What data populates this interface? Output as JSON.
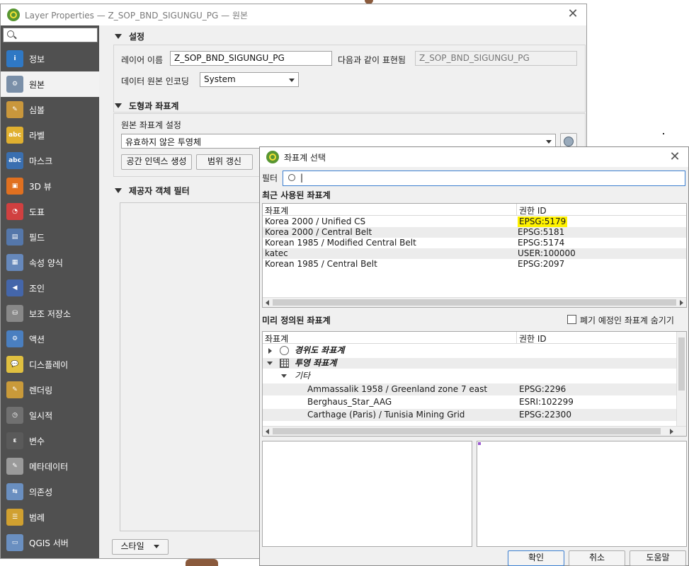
{
  "main_window": {
    "title": "Layer Properties — Z_SOP_BND_SIGUNGU_PG — 원본",
    "close_glyph": "✕"
  },
  "sidebar": {
    "search_placeholder": "",
    "items": [
      {
        "label": "정보",
        "icon": "info-icon",
        "color": "#2f78c4",
        "glyph": "i"
      },
      {
        "label": "원본",
        "icon": "source-settings-icon",
        "color": "#7a8fa8",
        "glyph": "⚙"
      },
      {
        "label": "심볼",
        "icon": "symbology-brush-icon",
        "color": "#c9973c",
        "glyph": "✎"
      },
      {
        "label": "라벨",
        "icon": "labels-abc-icon",
        "color": "#e0b030",
        "glyph": "abc"
      },
      {
        "label": "마스크",
        "icon": "masks-abc-icon",
        "color": "#3a6fb0",
        "glyph": "abc"
      },
      {
        "label": "3D 뷰",
        "icon": "3d-cube-icon",
        "color": "#e07020",
        "glyph": "▣"
      },
      {
        "label": "도표",
        "icon": "diagrams-icon",
        "color": "#d04040",
        "glyph": "◔"
      },
      {
        "label": "필드",
        "icon": "fields-icon",
        "color": "#5577aa",
        "glyph": "▤"
      },
      {
        "label": "속성 양식",
        "icon": "attributes-form-icon",
        "color": "#6688bb",
        "glyph": "▦"
      },
      {
        "label": "조인",
        "icon": "joins-icon",
        "color": "#4466aa",
        "glyph": "◀"
      },
      {
        "label": "보조 저장소",
        "icon": "auxiliary-storage-icon",
        "color": "#888888",
        "glyph": "⛁"
      },
      {
        "label": "액션",
        "icon": "actions-gear-icon",
        "color": "#4a7fc0",
        "glyph": "⚙"
      },
      {
        "label": "디스플레이",
        "icon": "display-tooltip-icon",
        "color": "#e0c040",
        "glyph": "💬"
      },
      {
        "label": "렌더링",
        "icon": "rendering-brush-icon",
        "color": "#c99a3a",
        "glyph": "✎"
      },
      {
        "label": "일시적",
        "icon": "temporal-clock-icon",
        "color": "#707070",
        "glyph": "◷"
      },
      {
        "label": "변수",
        "icon": "variables-epsilon-icon",
        "color": "#5a5a5a",
        "glyph": "ε"
      },
      {
        "label": "메타데이터",
        "icon": "metadata-icon",
        "color": "#9a9a9a",
        "glyph": "✎"
      },
      {
        "label": "의존성",
        "icon": "dependencies-icon",
        "color": "#6a8fc0",
        "glyph": "⇆"
      },
      {
        "label": "범례",
        "icon": "legend-icon",
        "color": "#d0a030",
        "glyph": "☰"
      },
      {
        "label": "QGIS 서버",
        "icon": "qgis-server-icon",
        "color": "#6a8fc0",
        "glyph": "▭"
      }
    ]
  },
  "settings": {
    "header": "설정",
    "layer_name_label": "레이어 이름",
    "layer_name_value": "Z_SOP_BND_SIGUNGU_PG",
    "display_as_label": "다음과 같이 표현됨",
    "display_as_value": "Z_SOP_BND_SIGUNGU_PG",
    "encoding_label": "데이터 원본 인코딩",
    "encoding_value": "System"
  },
  "geometry": {
    "header": "도형과 좌표계",
    "crs_label": "원본 좌표계 설정",
    "crs_value": "유효하지 않은 투영체",
    "spatial_index_button": "공간 인덱스 생성",
    "update_extents_button": "범위 갱신"
  },
  "provider_filter": {
    "header": "제공자 객체 필터"
  },
  "bottom": {
    "style_button": "스타일"
  },
  "crs_dialog": {
    "title": "좌표계 선택",
    "close_glyph": "✕",
    "filter_label": "필터",
    "filter_value": "|",
    "recent_header": "최근 사용된 좌표계",
    "col_crs": "좌표계",
    "col_authority": "권한 ID",
    "recent_rows": [
      {
        "name": "Korea 2000 / Unified CS",
        "id": "EPSG:5179"
      },
      {
        "name": "Korea 2000 / Central Belt",
        "id": "EPSG:5181"
      },
      {
        "name": "Korean 1985 / Modified Central Belt",
        "id": "EPSG:5174"
      },
      {
        "name": "katec",
        "id": "USER:100000"
      },
      {
        "name": "Korean 1985 / Central Belt",
        "id": "EPSG:2097"
      }
    ],
    "predefined_header": "미리 정의된 좌표계",
    "hide_deprecated_label": "폐기 예정인 좌표계 숨기기",
    "tree": {
      "geographic": "경위도 좌표계",
      "projected": "투영 좌표계",
      "other": "기타"
    },
    "predefined_rows": [
      {
        "name": "Ammassalik 1958 / Greenland zone 7 east",
        "id": "EPSG:2296"
      },
      {
        "name": "Berghaus_Star_AAG",
        "id": "ESRI:102299"
      },
      {
        "name": "Carthage (Paris) / Tunisia Mining Grid",
        "id": "EPSG:22300"
      }
    ],
    "ok_button": "확인",
    "cancel_button": "취소",
    "help_button": "도움말"
  }
}
